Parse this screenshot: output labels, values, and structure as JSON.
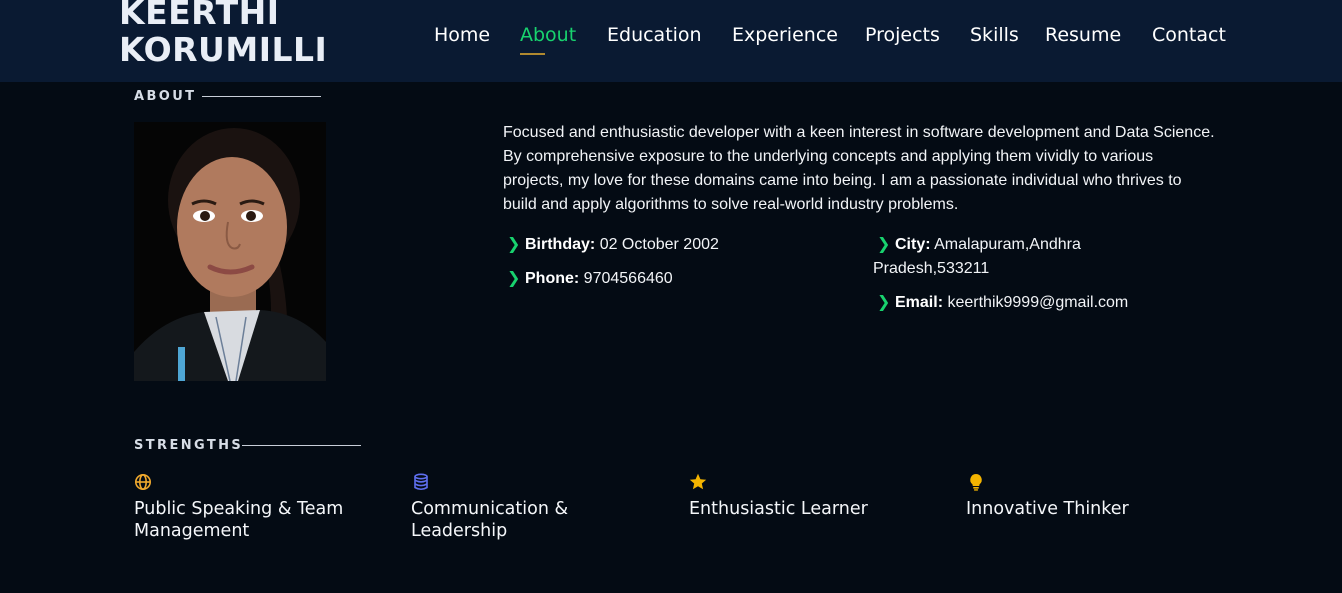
{
  "header": {
    "logo_line1": "KEERTHI",
    "logo_line2": "KORUMILLI"
  },
  "nav": {
    "items": [
      "Home",
      "About",
      "Education",
      "Experience",
      "Projects",
      "Skills",
      "Resume",
      "Contact"
    ],
    "active": "About"
  },
  "about": {
    "title": "ABOUT",
    "bio": "Focused and enthusiastic developer with a keen interest in software development and Data Science. By comprehensive exposure to the underlying concepts and applying them vividly to various projects, my love for these domains came into being. I am a passionate individual who thrives to build and apply algorithms to solve real-world industry problems.",
    "birthday_label": "Birthday:",
    "birthday_value": "02 October 2002",
    "phone_label": "Phone:",
    "phone_value": "9704566460",
    "city_label": "City:",
    "city_value": "Amalapuram,Andhra Pradesh,533211",
    "email_label": "Email:",
    "email_value": "keerthik9999@gmail.com"
  },
  "strengths": {
    "title": "STRENGTHS",
    "items": [
      {
        "icon": "globe-icon",
        "label": "Public Speaking & Team Management",
        "color": "#f0a92e"
      },
      {
        "icon": "database-icon",
        "label": "Communication & Leadership",
        "color": "#5f6ff0"
      },
      {
        "icon": "star-icon",
        "label": "Enthusiastic Learner",
        "color": "#f4b400"
      },
      {
        "icon": "lightbulb-icon",
        "label": "Innovative Thinker",
        "color": "#f4b400"
      }
    ]
  },
  "colors": {
    "accent": "#18d26e",
    "background": "#040b14",
    "header": "#0a1a32"
  }
}
